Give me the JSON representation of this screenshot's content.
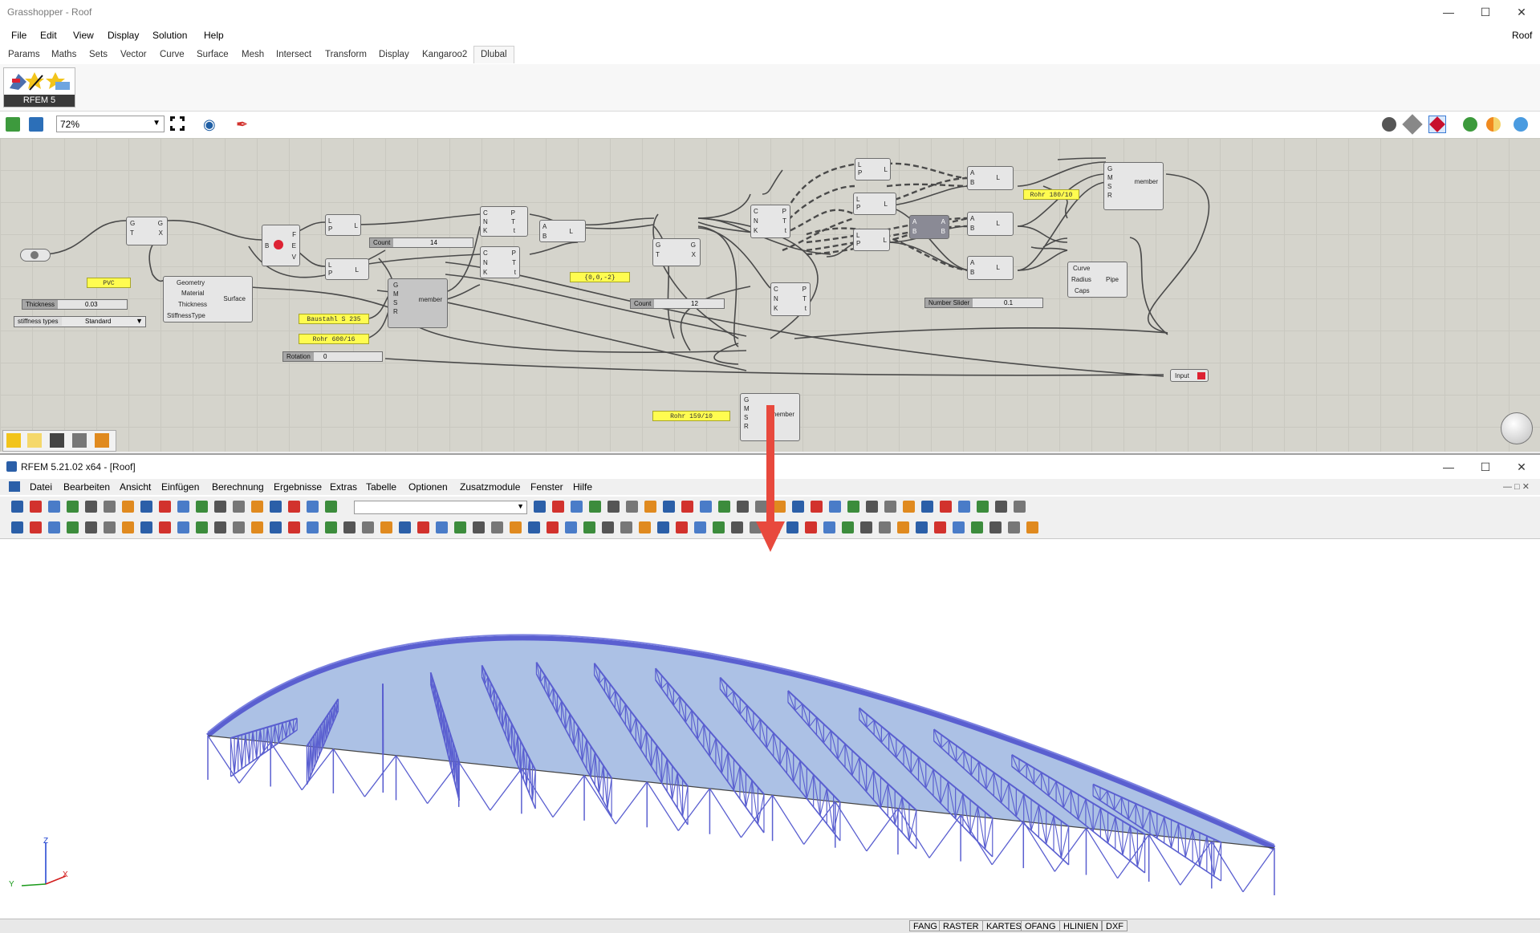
{
  "gh": {
    "title": "Grasshopper - Roof",
    "doc_name": "Roof",
    "menu": [
      "File",
      "Edit",
      "View",
      "Display",
      "Solution",
      "Help"
    ],
    "tabs": [
      "Params",
      "Maths",
      "Sets",
      "Vector",
      "Curve",
      "Surface",
      "Mesh",
      "Intersect",
      "Transform",
      "Display",
      "Kangaroo2",
      "Dlubal"
    ],
    "active_tab": "Dlubal",
    "ribbon_group": "RFEM 5",
    "zoom": "72%",
    "canvas": {
      "panel_pvc": "PVC",
      "panel_point": "{0,0,-2}",
      "panel_baustahl": "Baustahl S 235",
      "panel_rohr1": "Rohr 600/16",
      "panel_rohr2": "Rohr 159/10",
      "panel_rohr3": "Rohr 180/10",
      "slider_thickness_label": "Thickness",
      "slider_thickness_value": "0.03",
      "slider_count1_label": "Count",
      "slider_count1_value": "14",
      "slider_count2_label": "Count",
      "slider_count2_value": "12",
      "slider_rotation_label": "Rotation",
      "slider_rotation_value": "0",
      "slider_number_label": "Number Slider",
      "slider_number_value": "0.1",
      "dropdown_stiffness_label": "stiffness types",
      "dropdown_stiffness_value": "Standard",
      "surface_inputs": [
        "Geometry",
        "Material",
        "Thickness",
        "StiffnessType"
      ],
      "surface_output": "Surface",
      "member_label": "member",
      "pipe_inputs": [
        "Curve",
        "Radius",
        "Caps"
      ],
      "pipe_output": "Pipe",
      "input_label": "Input"
    }
  },
  "rfem": {
    "title": "RFEM 5.21.02 x64 - [Roof]",
    "menu": [
      "Datei",
      "Bearbeiten",
      "Ansicht",
      "Einfügen",
      "Berechnung",
      "Ergebnisse",
      "Extras",
      "Tabelle",
      "Optionen",
      "Zusatzmodule",
      "Fenster",
      "Hilfe"
    ],
    "axis": {
      "x": "X",
      "y": "Y",
      "z": "Z"
    },
    "status": [
      "FANG",
      "RASTER",
      "KARTES",
      "OFANG",
      "HLINIEN",
      "DXF"
    ]
  },
  "colors": {
    "roof_fill": "#9db6e0",
    "truss": "#5a5fd0",
    "arrow": "#e8493d",
    "wire": "#4a4a4a"
  }
}
